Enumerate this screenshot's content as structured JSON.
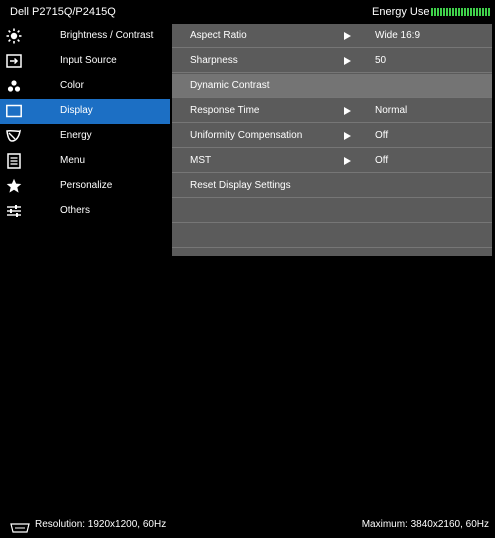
{
  "header": {
    "model": "Dell P2715Q/P2415Q",
    "energy_label": "Energy Use",
    "energy_level": 1.0,
    "energy_color": "#3fd14a"
  },
  "sidebar": {
    "items": [
      {
        "label": "Brightness / Contrast",
        "icon": "brightness-icon"
      },
      {
        "label": "Input Source",
        "icon": "input-source-icon"
      },
      {
        "label": "Color",
        "icon": "color-dots-icon"
      },
      {
        "label": "Display",
        "icon": "display-icon",
        "active": true
      },
      {
        "label": "Energy",
        "icon": "energy-leaf-icon"
      },
      {
        "label": "Menu",
        "icon": "menu-icon"
      },
      {
        "label": "Personalize",
        "icon": "star-icon"
      },
      {
        "label": "Others",
        "icon": "others-sliders-icon"
      }
    ]
  },
  "panel": {
    "rows": [
      {
        "label": "Aspect Ratio",
        "value": "Wide 16:9",
        "arrow": true
      },
      {
        "label": "Sharpness",
        "value": "50",
        "arrow": true
      },
      {
        "label": "Dynamic Contrast",
        "value": "",
        "arrow": false,
        "active": true
      },
      {
        "label": "Response Time",
        "value": "Normal",
        "arrow": true
      },
      {
        "label": "Uniformity Compensation",
        "value": "Off",
        "arrow": true
      },
      {
        "label": "MST",
        "value": "Off",
        "arrow": true
      },
      {
        "label": "Reset Display Settings",
        "value": "",
        "arrow": false
      }
    ]
  },
  "footer": {
    "resolution": "Resolution: 1920x1200, 60Hz",
    "maximum": "Maximum: 3840x2160, 60Hz"
  },
  "colors": {
    "active_sidebar": "#1c6fc4",
    "panel_bg": "#5b5b5b",
    "active_row": "#747474"
  }
}
